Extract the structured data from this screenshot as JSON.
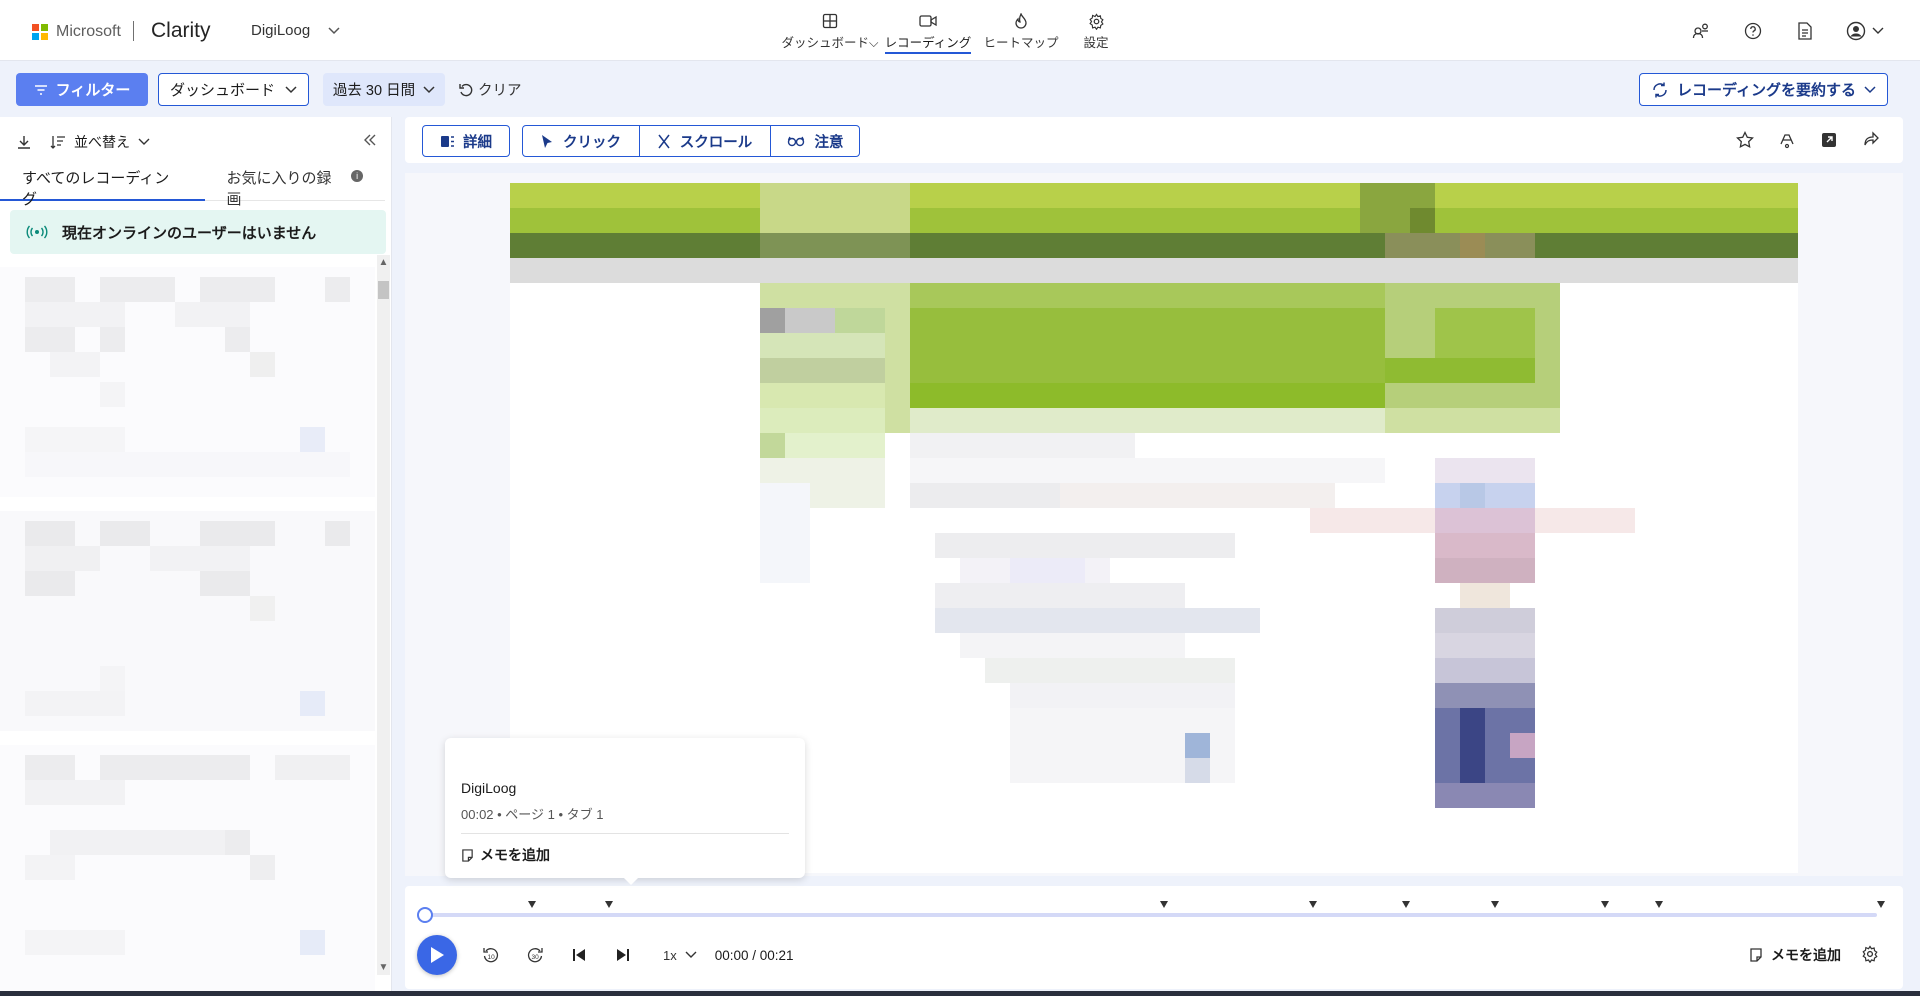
{
  "header": {
    "ms_text": "Microsoft",
    "brand": "Clarity",
    "project": "DigiLoog",
    "nav": [
      {
        "label": "ダッシュボード⌵",
        "icon": "dashboard-icon"
      },
      {
        "label": "レコーディング",
        "icon": "video-icon",
        "active": true
      },
      {
        "label": "ヒートマップ",
        "icon": "flame-icon"
      },
      {
        "label": "設定",
        "icon": "gear-icon"
      }
    ]
  },
  "toolbar": {
    "filter_label": "フィルター",
    "dashboard_label": "ダッシュボード",
    "range_label": "過去 30 日間",
    "clear_label": "クリア",
    "summary_label": "レコーディングを要約する"
  },
  "leftpanel": {
    "sort_label": "並べ替え",
    "tabs": [
      "すべてのレコーディング",
      "お気に入りの録画"
    ],
    "online_banner": "現在オンラインのユーザーはいません"
  },
  "replay_tools": {
    "detail_label": "詳細",
    "click_label": "クリック",
    "scroll_label": "スクロール",
    "attention_label": "注意"
  },
  "tooltip": {
    "title": "DigiLoog",
    "meta": "00:02 • ページ 1 • タブ 1",
    "note_label": "メモを追加"
  },
  "player": {
    "speed": "1x",
    "time": "00:00 / 00:21",
    "note_label": "メモを追加",
    "progress": 0
  },
  "colors": {
    "accent": "#2458d6",
    "filter_bg": "#5b7ff0",
    "banner_bg": "#e4f6f2"
  }
}
